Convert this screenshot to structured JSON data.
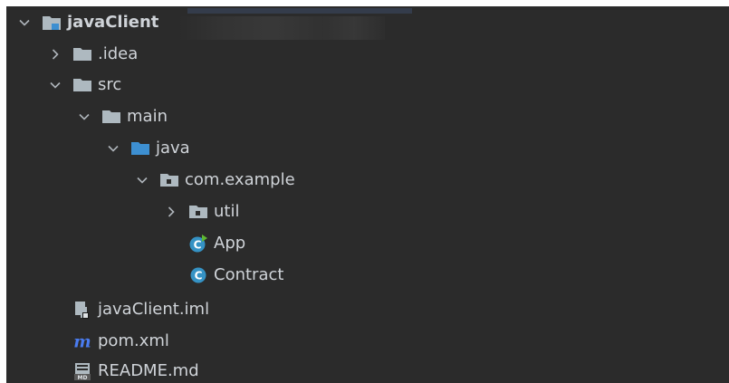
{
  "tree": {
    "root": {
      "label": "javaClient",
      "expanded": true
    },
    "items": [
      {
        "label": ".idea",
        "expanded": false
      },
      {
        "label": "src",
        "expanded": true
      },
      {
        "label": "main",
        "expanded": true
      },
      {
        "label": "java",
        "expanded": true
      },
      {
        "label": "com.example",
        "expanded": true
      },
      {
        "label": "util",
        "expanded": false
      },
      {
        "label": "App"
      },
      {
        "label": "Contract"
      },
      {
        "label": "javaClient.iml"
      },
      {
        "label": "pom.xml"
      },
      {
        "label": "README.md"
      }
    ]
  },
  "icons": {
    "root": "module-folder-icon",
    "idea": "folder-icon",
    "src": "folder-icon",
    "main": "folder-icon",
    "java": "source-folder-icon",
    "com_example": "package-icon",
    "util": "package-icon",
    "App": "java-class-main-icon",
    "Contract": "java-class-icon",
    "iml": "module-file-icon",
    "pom": "maven-icon",
    "readme": "markdown-icon"
  },
  "colors": {
    "background": "#2b2b2b",
    "text": "#cfd3d8",
    "folder": "#aeb9c0",
    "source_folder": "#3d8fd1",
    "class": "#3592c4",
    "maven": "#4a7cf0"
  }
}
